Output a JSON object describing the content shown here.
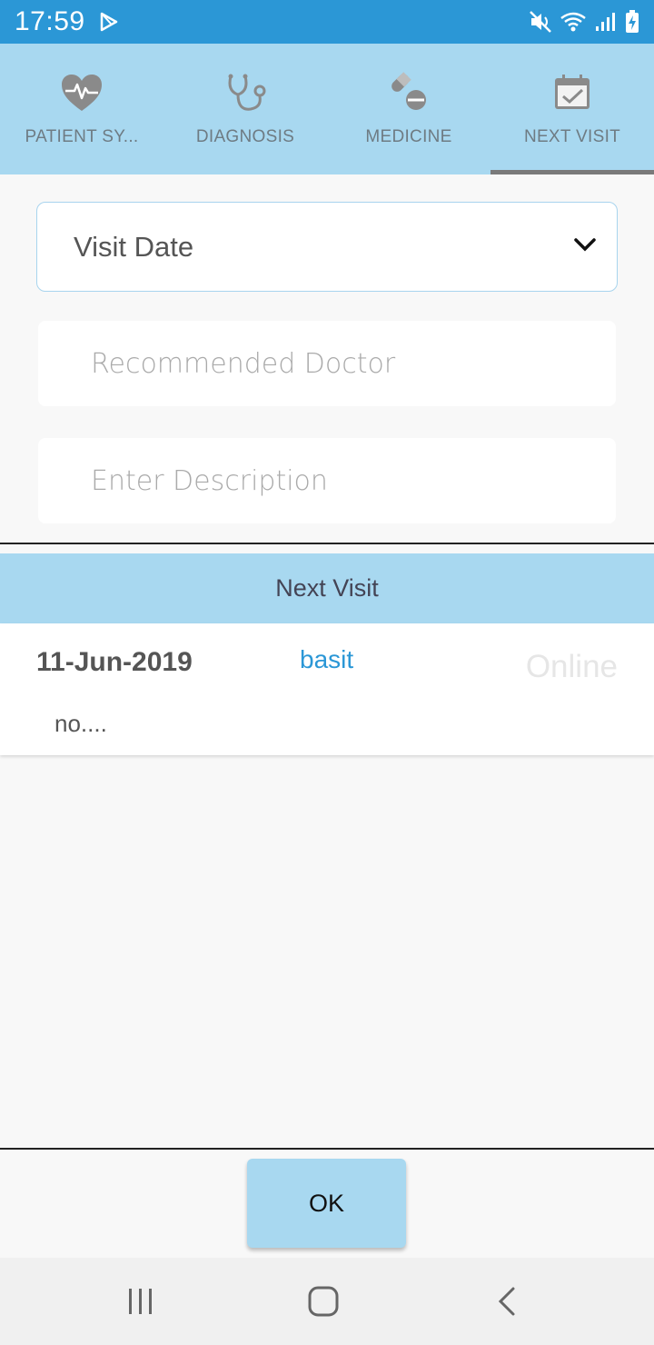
{
  "status_bar": {
    "time": "17:59",
    "icons": [
      "play-store-icon",
      "mute-icon",
      "wifi-icon",
      "signal-icon",
      "battery-charging-icon"
    ]
  },
  "tabs": [
    {
      "label": "PATIENT SY...",
      "icon": "heart-pulse-icon",
      "active": false
    },
    {
      "label": "DIAGNOSIS",
      "icon": "stethoscope-icon",
      "active": false
    },
    {
      "label": "MEDICINE",
      "icon": "pills-icon",
      "active": false
    },
    {
      "label": "NEXT VISIT",
      "icon": "calendar-check-icon",
      "active": true
    }
  ],
  "form": {
    "visit_date_label": "Visit Date",
    "doctor_placeholder": "Recommended Doctor",
    "description_placeholder": "Enter Description"
  },
  "section_title": "Next Visit",
  "visits": [
    {
      "date": "11-Jun-2019",
      "doctor": "basit",
      "status": "Online",
      "description": "no...."
    }
  ],
  "ok_label": "OK",
  "colors": {
    "status_bar": "#2b97d6",
    "tab_bar": "#a8d8f0",
    "accent_link": "#2b97d6",
    "active_indicator": "#7a7a7a"
  },
  "nav_bar": [
    "recent-apps-icon",
    "home-icon",
    "back-icon"
  ]
}
